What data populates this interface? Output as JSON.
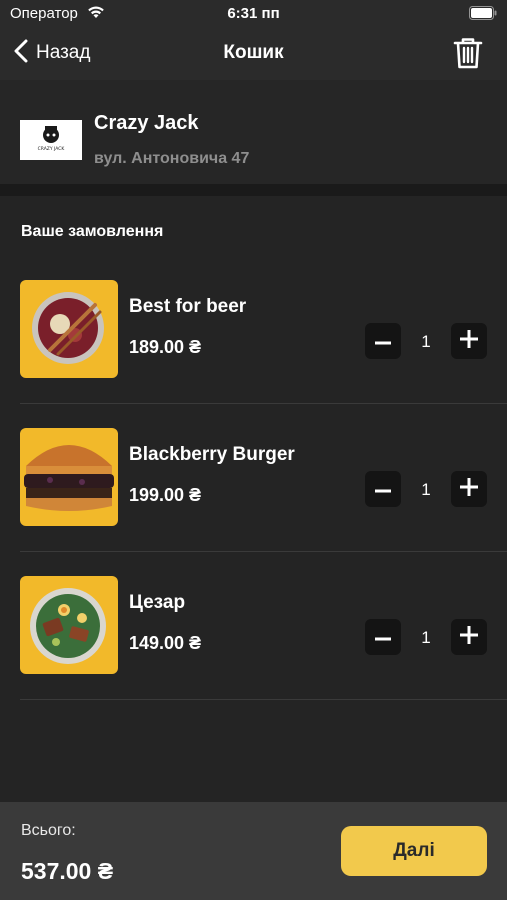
{
  "status_bar": {
    "carrier": "Оператор",
    "time": "6:31 пп"
  },
  "nav": {
    "back_label": "Назад",
    "title": "Кошик"
  },
  "restaurant": {
    "name": "Crazy Jack",
    "address": "вул. Антоновича 47",
    "logo_text": "CRAZY JACK"
  },
  "order": {
    "section_title": "Ваше замовлення",
    "items": [
      {
        "title": "Best for beer",
        "price": "189.00 ₴",
        "quantity": "1"
      },
      {
        "title": "Blackberry Burger",
        "price": "199.00 ₴",
        "quantity": "1"
      },
      {
        "title": "Цезар",
        "price": "149.00 ₴",
        "quantity": "1"
      }
    ]
  },
  "footer": {
    "total_label": "Всього:",
    "total": "537.00 ₴",
    "next_label": "Далі"
  },
  "colors": {
    "accent": "#f2c94c",
    "background": "#242424",
    "thumb_bg": "#f2b92a"
  }
}
